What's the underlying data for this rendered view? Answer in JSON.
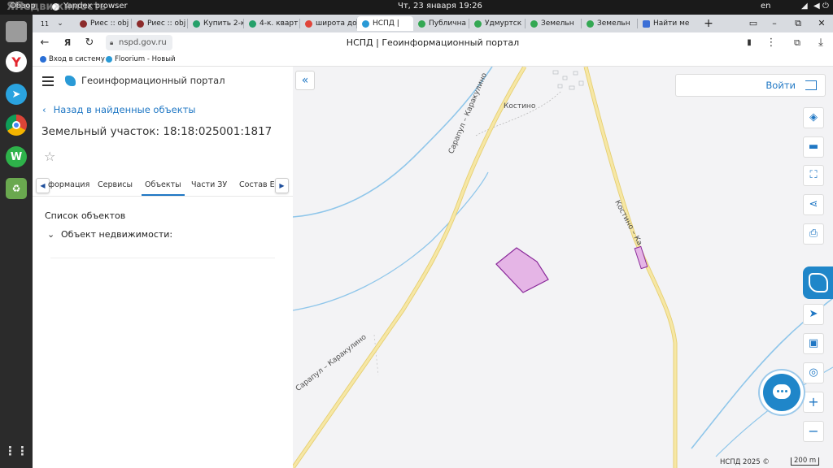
{
  "os": {
    "activities": "Обзор",
    "app_name": "Yandex browser",
    "clock": "Чт, 23 января  19:26",
    "lang": "en",
    "watermark": "ЯНедвижимость"
  },
  "browser": {
    "tab_count": "11",
    "tabs": [
      {
        "label": "Риес :: obj",
        "color": "#8c2b2b"
      },
      {
        "label": "Риес :: obj",
        "color": "#8c2b2b"
      },
      {
        "label": "Купить 2-к",
        "color": "#25a06a"
      },
      {
        "label": "4-к. кварт",
        "color": "#25a06a"
      },
      {
        "label": "широта до",
        "color": "#e0453a"
      },
      {
        "label": "НСПД |",
        "color": "#2a9ad6"
      },
      {
        "label": "Публична",
        "color": "#34a853"
      },
      {
        "label": "Удмуртск",
        "color": "#34a853"
      },
      {
        "label": "Земельн",
        "color": "#34a853"
      },
      {
        "label": "Земельн",
        "color": "#34a853"
      },
      {
        "label": "Найти ме",
        "color": "#3c6fd6"
      }
    ],
    "url": "nspd.gov.ru",
    "page_title": "НСПД | Геоинформационный портал",
    "bookmarks": [
      {
        "label": "Вход в систему",
        "color": "#2a6fd6"
      },
      {
        "label": "Floorium - Новый",
        "color": "#2a9ad6"
      }
    ]
  },
  "panel": {
    "portal_name": "Геоинформационный портал",
    "back_link": "Назад в найденные объекты",
    "title": "Земельный участок: 18:18:025001:1817",
    "tabs": [
      "формация",
      "Сервисы",
      "Объекты",
      "Части ЗУ",
      "Состав ЕЗ"
    ],
    "active_tab": "Объекты",
    "list_title": "Список объектов",
    "object_row": "Объект недвижимости:"
  },
  "map": {
    "labels": {
      "village": "Костино",
      "road_west_upper": "Сарапул – Каракулино",
      "road_west_lower": "Сарапул – Каракулино",
      "road_east": "Костино – Ка"
    },
    "login": "Войти",
    "copyright": "НСПД 2025 ©",
    "scale": "200 m",
    "colors": {
      "parcel_fill": "#e5b5e6",
      "parcel_stroke": "#8a2a9a",
      "road": "#f2df8e",
      "river": "#8fc6ea",
      "accent": "#1f77c4"
    }
  }
}
